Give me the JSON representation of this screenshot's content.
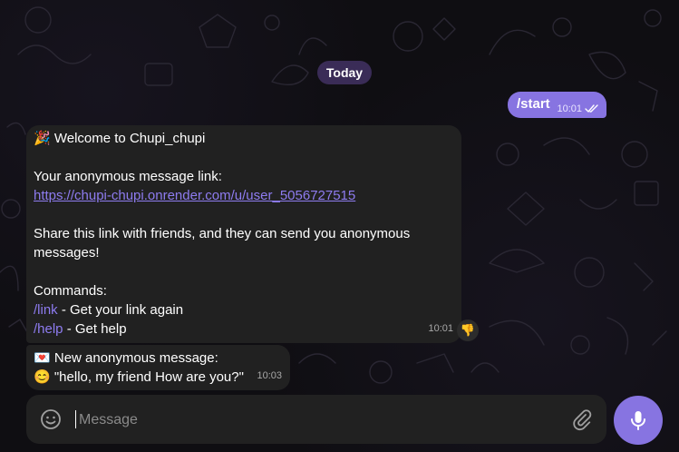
{
  "chat": {
    "date_label": "Today",
    "messages": [
      {
        "direction": "outgoing",
        "text": "/start",
        "time": "10:01",
        "status": "read-double-check"
      },
      {
        "direction": "incoming",
        "emoji": "🎉",
        "lines": [
          "Welcome to Chupi_chupi",
          "",
          "Your anonymous message link:",
          "https://chupi-chupi.onrender.com/u/user_5056727515",
          "",
          "Share this link with friends, and they can send you anonymous",
          "messages!",
          "",
          "Commands:"
        ],
        "commands": [
          {
            "cmd": "/link",
            "desc": " - Get your link again"
          },
          {
            "cmd": "/help",
            "desc": " - Get help"
          }
        ],
        "time": "10:01",
        "reaction": "👎"
      },
      {
        "direction": "incoming",
        "emoji_top": "💌",
        "line1": "New anonymous message:",
        "emoji_bottom": "😊",
        "line2": "\"hello, my friend How are you?\"",
        "time": "10:03"
      }
    ]
  },
  "composer": {
    "placeholder": "Message",
    "value": "",
    "icons": {
      "emoji": "smiley-icon",
      "attach": "paperclip-icon",
      "send": "microphone-icon"
    }
  },
  "colors": {
    "accent": "#8774e1",
    "bubble_in": "#212121",
    "link": "#8e7cf0",
    "date_pill": "#3a2c57"
  }
}
